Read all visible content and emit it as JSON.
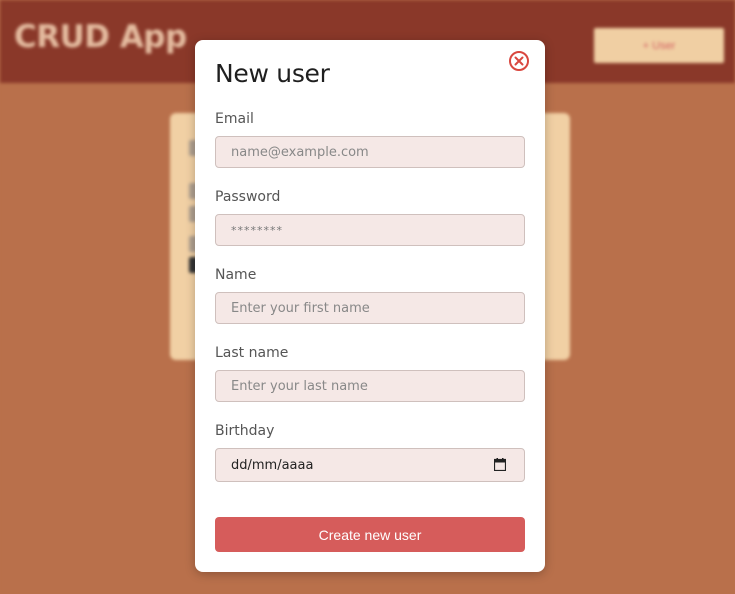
{
  "app": {
    "title": "CRUD App",
    "add_button_label": "+ User"
  },
  "modal": {
    "title": "New user",
    "fields": [
      {
        "label": "Email",
        "placeholder": "name@example.com"
      },
      {
        "label": "Password",
        "placeholder": "********"
      },
      {
        "label": "Name",
        "placeholder": "Enter your first name"
      },
      {
        "label": "Last name",
        "placeholder": "Enter your last name"
      },
      {
        "label": "Birthday",
        "placeholder": "dd/mm/aaaa"
      }
    ],
    "submit_label": "Create new user"
  },
  "colors": {
    "header": "#8a3829",
    "background": "#b9704b",
    "card": "#f1d0a4",
    "accent": "#d65c5b",
    "input_bg": "#f5e8e6"
  },
  "icons": {
    "close": "close-circle-icon",
    "calendar": "calendar-icon"
  }
}
